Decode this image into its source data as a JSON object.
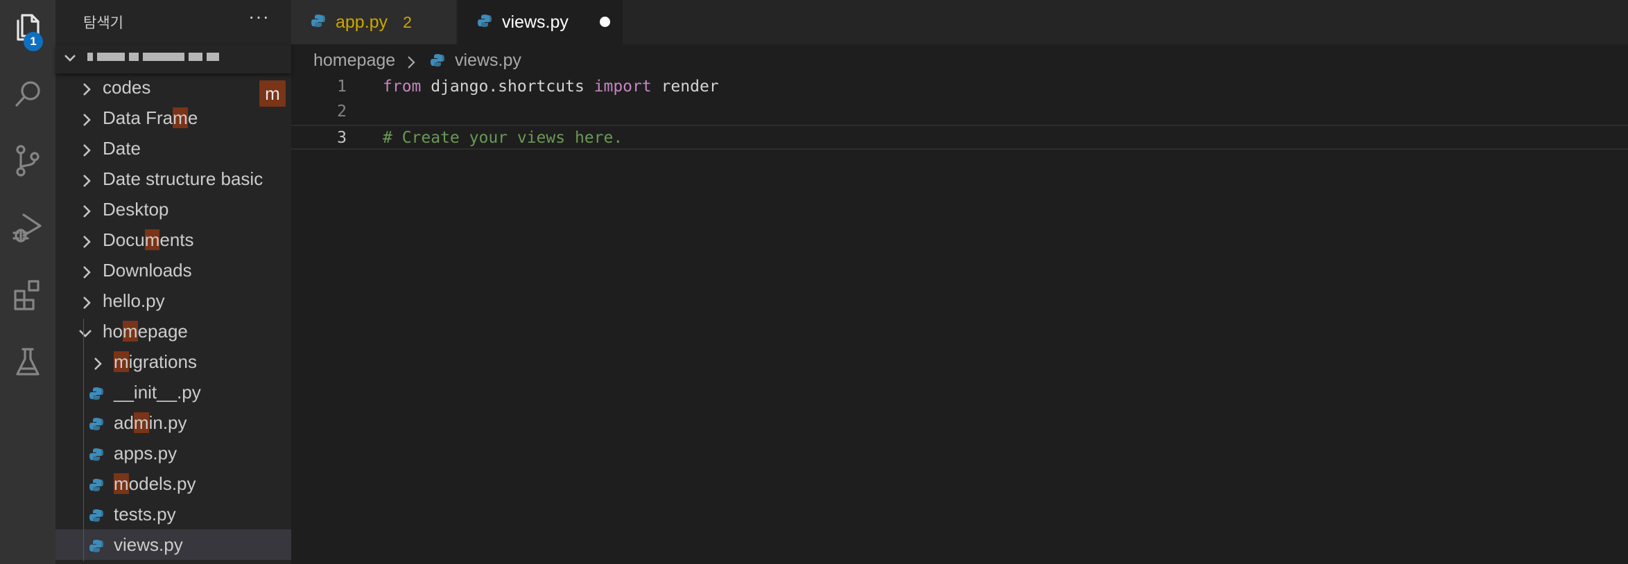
{
  "activity_bar": {
    "items": [
      {
        "name": "explorer",
        "icon": "files-icon",
        "badge": "1"
      },
      {
        "name": "search",
        "icon": "search-icon"
      },
      {
        "name": "source-control",
        "icon": "source-control-icon"
      },
      {
        "name": "run-debug",
        "icon": "run-debug-icon"
      },
      {
        "name": "extensions",
        "icon": "extensions-icon"
      },
      {
        "name": "testing",
        "icon": "flask-icon"
      }
    ]
  },
  "sidebar": {
    "title": "탐색기",
    "more": "···",
    "filter_badge": "m",
    "tree": [
      {
        "label": "codes",
        "type": "folder",
        "expanded": false
      },
      {
        "label_pre": "Data Fra",
        "label_hl": "m",
        "label_post": "e",
        "type": "folder",
        "expanded": false
      },
      {
        "label": "Date",
        "type": "folder",
        "expanded": false
      },
      {
        "label": "Date structure basic",
        "type": "folder",
        "expanded": false
      },
      {
        "label": "Desktop",
        "type": "folder",
        "expanded": false
      },
      {
        "label_pre": "Docu",
        "label_hl": "m",
        "label_post": "ents",
        "type": "folder",
        "expanded": false
      },
      {
        "label": "Downloads",
        "type": "folder",
        "expanded": false
      },
      {
        "label": "hello.py",
        "type": "folder",
        "expanded": false
      },
      {
        "label_pre": "ho",
        "label_hl": "m",
        "label_post": "epage",
        "type": "folder",
        "expanded": true
      },
      {
        "label_pre": "",
        "label_hl": "m",
        "label_post": "igrations",
        "type": "folder",
        "expanded": false
      },
      {
        "label": "__init__.py",
        "type": "python-file"
      },
      {
        "label_pre": "ad",
        "label_hl": "m",
        "label_post": "in.py",
        "type": "python-file"
      },
      {
        "label": "apps.py",
        "type": "python-file"
      },
      {
        "label_pre": "",
        "label_hl": "m",
        "label_post": "odels.py",
        "type": "python-file"
      },
      {
        "label": "tests.py",
        "type": "python-file"
      },
      {
        "label": "views.py",
        "type": "python-file",
        "selected": true
      }
    ]
  },
  "tabs": [
    {
      "label": "app.py",
      "count": "2",
      "color": "#cca700"
    },
    {
      "label": "views.py",
      "dirty": true
    }
  ],
  "breadcrumb": {
    "folder": "homepage",
    "file": "views.py"
  },
  "editor": {
    "lines": [
      {
        "number": "1",
        "from_kw": "from",
        "module": " django.shortcuts ",
        "import_kw": "import",
        "name": " render"
      },
      {
        "number": "2",
        "text": ""
      },
      {
        "number": "3",
        "comment": "# Create your views here."
      }
    ],
    "current_line": "3"
  },
  "colors": {
    "keyword": "#c586c0",
    "comment": "#6a9955",
    "match_highlight": "#7a3417",
    "badge": "#0e70c0"
  }
}
